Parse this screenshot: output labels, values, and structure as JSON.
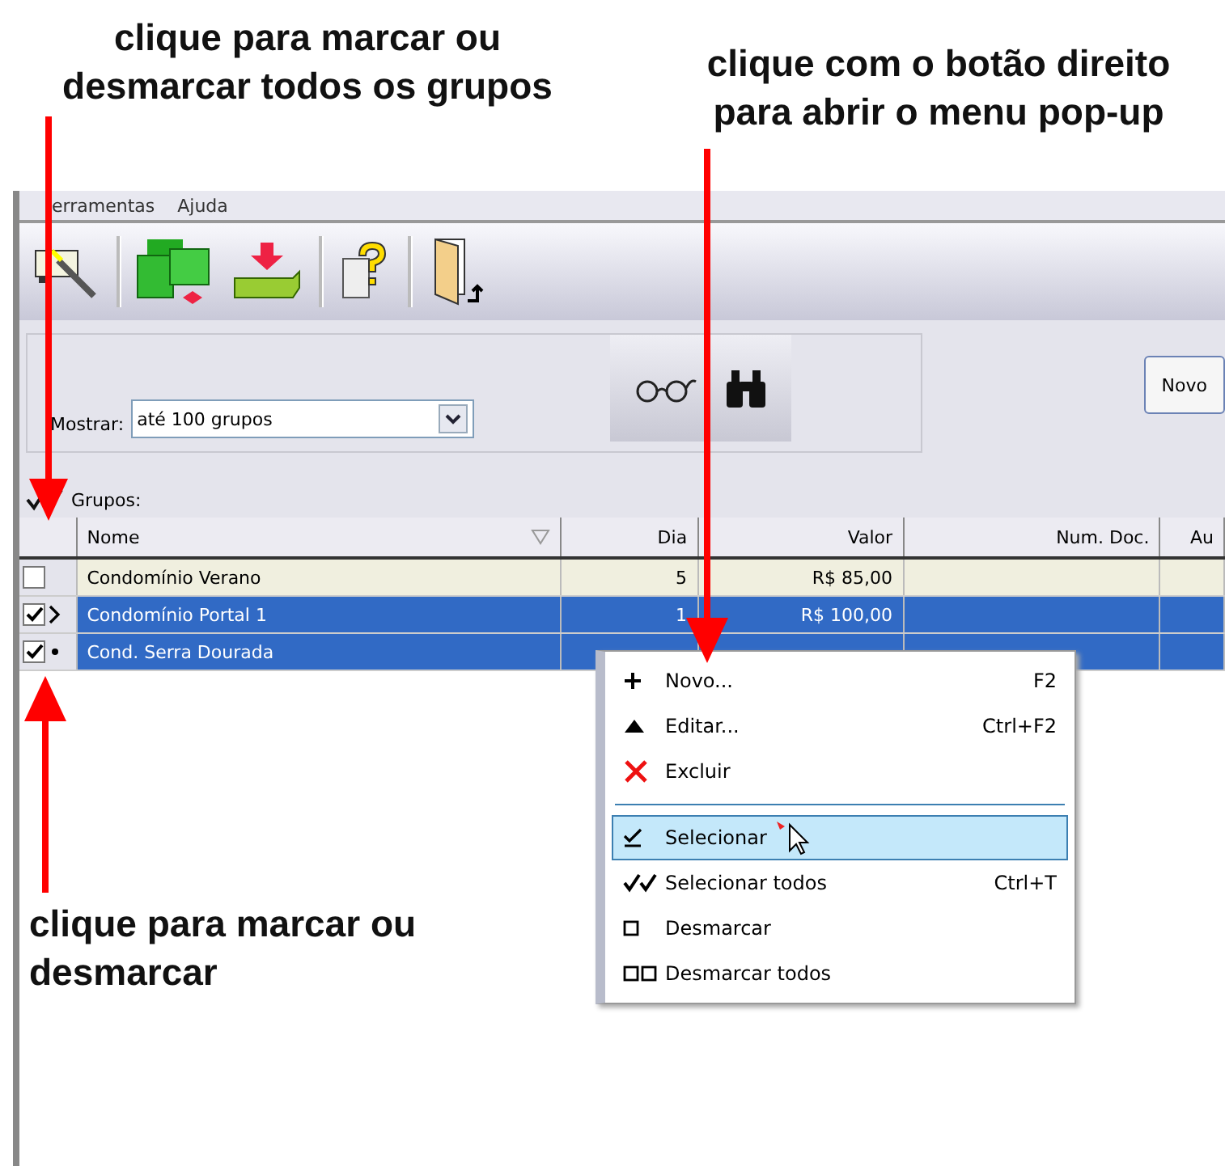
{
  "annotations": {
    "top_left": "clique para marcar ou desmarcar todos os grupos",
    "top_right": "clique com o botão direito para abrir o menu pop-up",
    "bottom_left": "clique para marcar ou desmarcar"
  },
  "menubar": [
    "erramentas",
    "Ajuda"
  ],
  "filter": {
    "label": "Mostrar:",
    "value": "até 100 grupos",
    "button": "Novo"
  },
  "groups_label": "Grupos:",
  "table": {
    "columns": [
      "Nome",
      "Dia",
      "Valor",
      "Num. Doc.",
      "Au"
    ],
    "rows": [
      {
        "cells": [
          "Condomínio Verano",
          "5",
          "R$ 85,00",
          "",
          ""
        ],
        "checked": false,
        "selected": false,
        "kind": "plain"
      },
      {
        "cells": [
          "Condomínio Portal 1",
          "1",
          "R$ 100,00",
          "",
          ""
        ],
        "checked": true,
        "selected": true,
        "kind": "current"
      },
      {
        "cells": [
          "Cond. Serra Dourada",
          "",
          "",
          "",
          ""
        ],
        "checked": true,
        "selected": true,
        "kind": "marked"
      }
    ]
  },
  "context_menu": [
    {
      "kind": "item",
      "label": "Novo...",
      "shortcut": "F2",
      "selected": false
    },
    {
      "kind": "item",
      "label": "Editar...",
      "shortcut": "Ctrl+F2",
      "selected": false
    },
    {
      "kind": "item",
      "label": "Excluir",
      "selected": false
    },
    {
      "kind": "separator"
    },
    {
      "kind": "item",
      "label": "Selecionar",
      "selected": true
    },
    {
      "kind": "item",
      "label": "Selecionar todos",
      "shortcut": "Ctrl+T",
      "selected": false
    },
    {
      "kind": "item",
      "label": "Desmarcar",
      "selected": false
    },
    {
      "kind": "item",
      "label": "Desmarcar todos",
      "selected": false
    }
  ]
}
